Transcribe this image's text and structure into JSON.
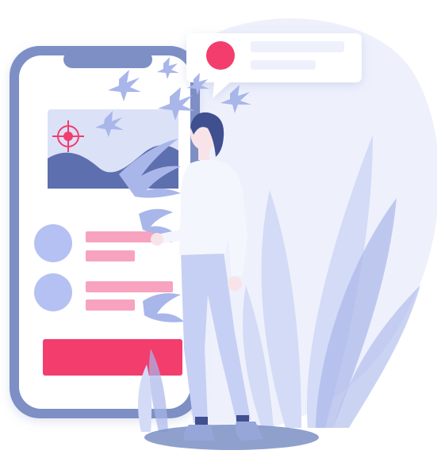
{
  "illustration": {
    "subject": "person-interacting-with-phone-app",
    "colors": {
      "background_blob": "#eef1fc",
      "phone_frame": "#7d8fc4",
      "phone_screen": "#ffffff",
      "accent_pink": "#f23d6d",
      "light_pink": "#f7a3bf",
      "avatar_blue": "#b5c1f3",
      "chart_fill": "#5d6fae",
      "chart_bg": "#dbe1f7",
      "leaf_light": "#d3dbf6",
      "leaf_mid": "#a9b6ea",
      "person_shirt": "#f4f6fd",
      "person_pants": "#c6d0f4",
      "person_hair": "#3f4f90",
      "person_skin": "#f8e4e8",
      "shoes": "#97a6d9"
    },
    "icons": [
      "target-icon",
      "notification-dot-icon",
      "leaf-icon"
    ]
  }
}
